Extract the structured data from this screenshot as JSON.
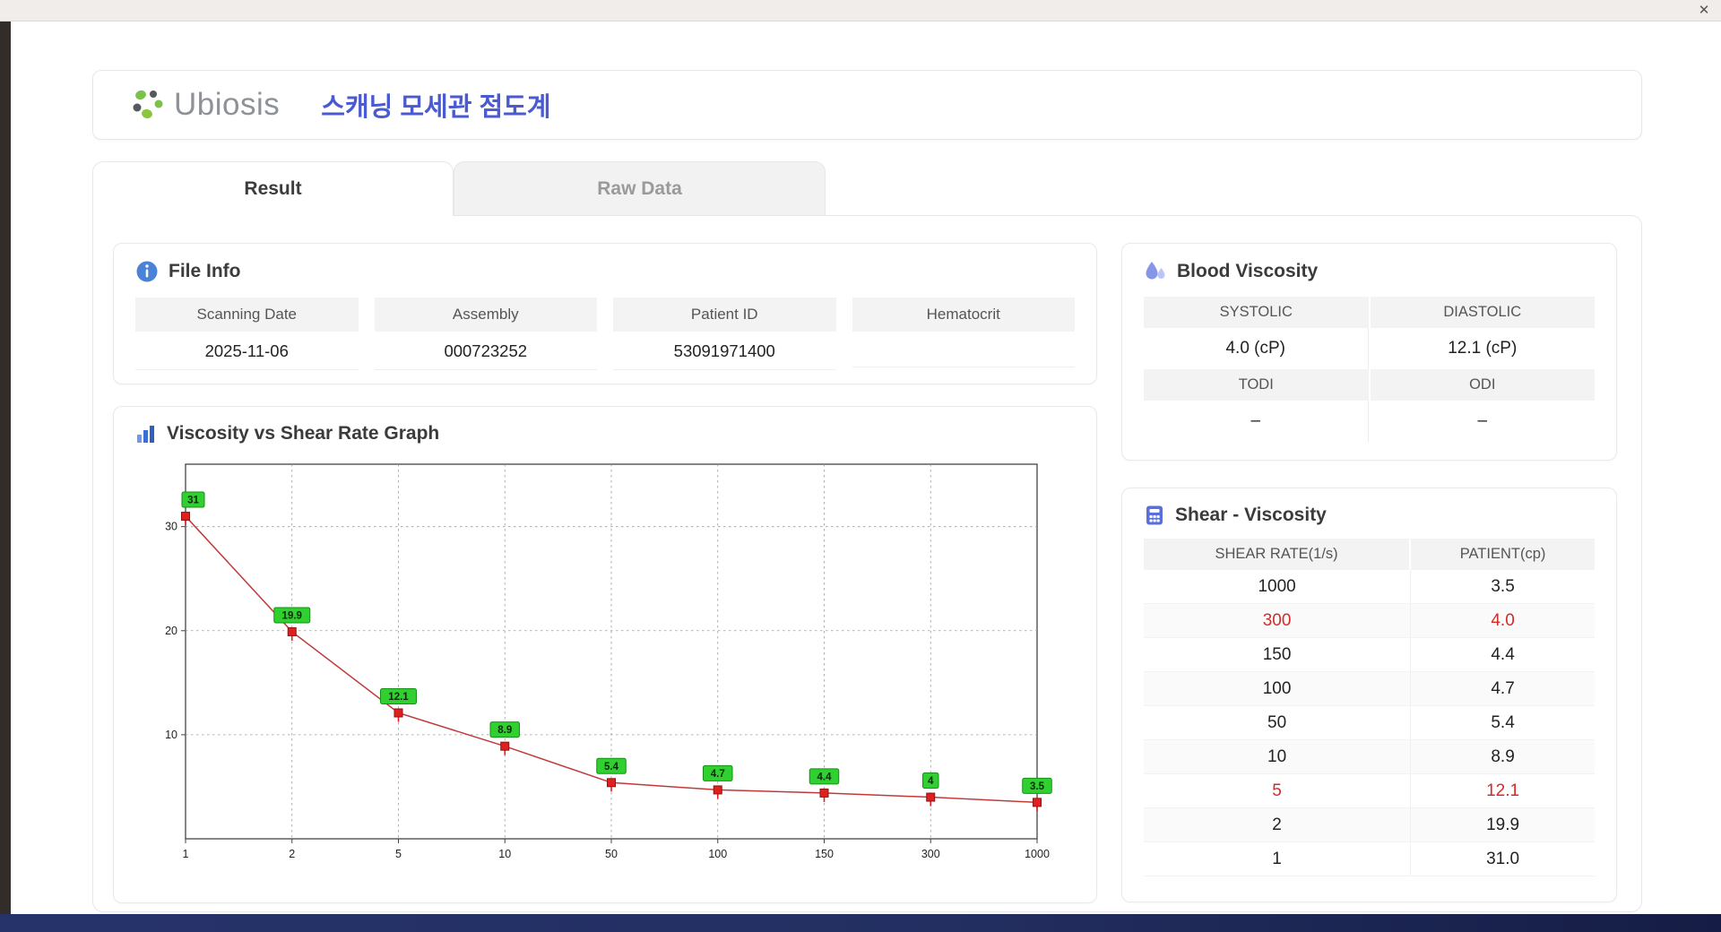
{
  "window": {
    "close_label": "✕"
  },
  "header": {
    "logo_text": "Ubiosis",
    "title": "스캐닝 모세관 점도계"
  },
  "tabs": {
    "result": "Result",
    "raw_data": "Raw Data"
  },
  "file_info": {
    "title": "File Info",
    "fields": [
      {
        "label": "Scanning Date",
        "value": "2025-11-06"
      },
      {
        "label": "Assembly",
        "value": "000723252"
      },
      {
        "label": "Patient ID",
        "value": "53091971400"
      },
      {
        "label": "Hematocrit",
        "value": ""
      }
    ]
  },
  "graph": {
    "title": "Viscosity vs Shear Rate Graph"
  },
  "blood_viscosity": {
    "title": "Blood Viscosity",
    "row1": {
      "label1": "SYSTOLIC",
      "label2": "DIASTOLIC",
      "value1": "4.0 (cP)",
      "value2": "12.1 (cP)"
    },
    "row2": {
      "label1": "TODI",
      "label2": "ODI",
      "value1": "–",
      "value2": "–"
    }
  },
  "shear_viscosity": {
    "title": "Shear - Viscosity",
    "columns": [
      "SHEAR RATE(1/s)",
      "PATIENT(cp)"
    ],
    "rows": [
      {
        "rate": "1000",
        "patient": "3.5",
        "highlight": false
      },
      {
        "rate": "300",
        "patient": "4.0",
        "highlight": true
      },
      {
        "rate": "150",
        "patient": "4.4",
        "highlight": false
      },
      {
        "rate": "100",
        "patient": "4.7",
        "highlight": false
      },
      {
        "rate": "50",
        "patient": "5.4",
        "highlight": false
      },
      {
        "rate": "10",
        "patient": "8.9",
        "highlight": false
      },
      {
        "rate": "5",
        "patient": "12.1",
        "highlight": true
      },
      {
        "rate": "2",
        "patient": "19.9",
        "highlight": false
      },
      {
        "rate": "1",
        "patient": "31.0",
        "highlight": false
      }
    ]
  },
  "chart_data": {
    "type": "line",
    "title": "Viscosity vs Shear Rate Graph",
    "x_categories": [
      "1",
      "2",
      "5",
      "10",
      "50",
      "100",
      "150",
      "300",
      "1000"
    ],
    "values": [
      31,
      19.9,
      12.1,
      8.9,
      5.4,
      4.7,
      4.4,
      4,
      3.5
    ],
    "point_labels": [
      "31",
      "19.9",
      "12.1",
      "8.9",
      "5.4",
      "4.7",
      "4.4",
      "4",
      "3.5"
    ],
    "y_ticks": [
      10,
      20,
      30
    ],
    "ylim": [
      0,
      36
    ],
    "xlabel": "",
    "ylabel": "",
    "grid": "dashed",
    "legend": "none",
    "line_color": "#c03a3a",
    "marker_color": "#e01f1f",
    "marker_border": "#8b1515",
    "label_bg": "#2fd02f",
    "label_border": "#169016"
  }
}
